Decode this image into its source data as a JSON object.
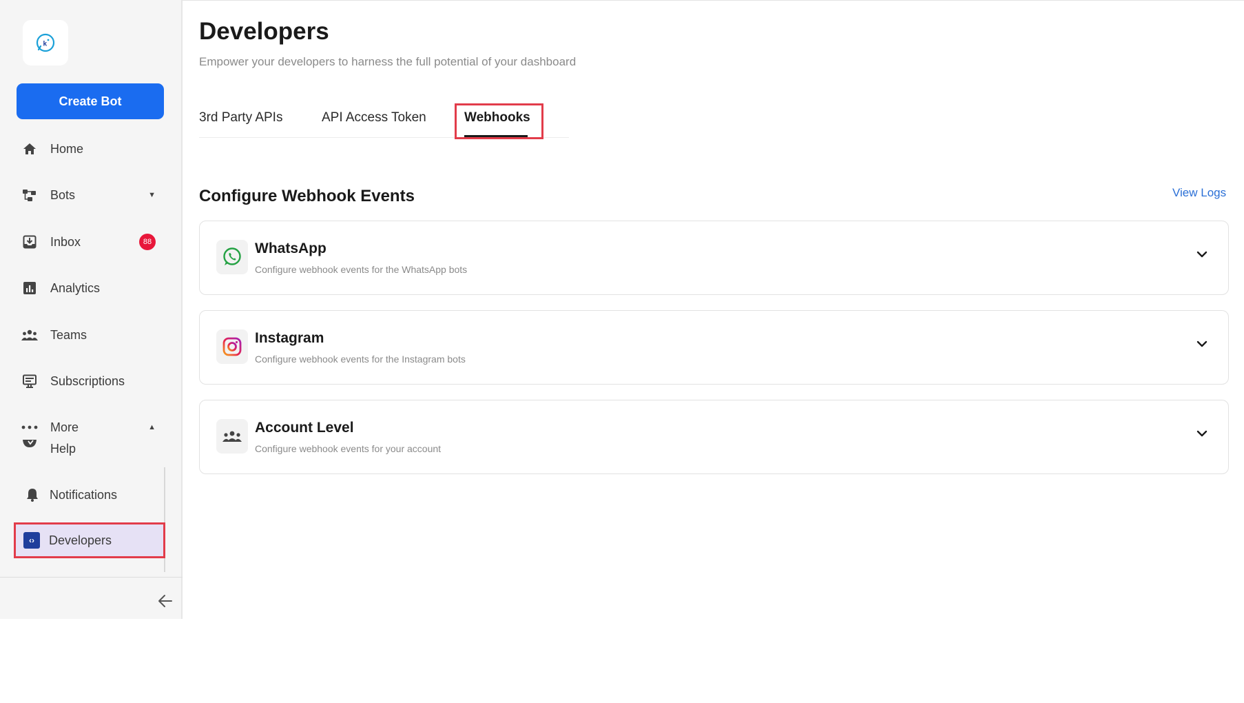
{
  "sidebar": {
    "logo_icon": "chat-bubble-logo-icon",
    "create_bot_label": "Create Bot",
    "items": [
      {
        "label": "Home",
        "icon": "home-icon"
      },
      {
        "label": "Bots",
        "icon": "bots-icon"
      },
      {
        "label": "Inbox",
        "icon": "inbox-icon",
        "badge": "88"
      },
      {
        "label": "Analytics",
        "icon": "analytics-icon"
      },
      {
        "label": "Teams",
        "icon": "teams-icon"
      },
      {
        "label": "Subscriptions",
        "icon": "subscriptions-icon"
      },
      {
        "label": "More",
        "icon": "more-icon"
      },
      {
        "label": "Help",
        "icon": "help-icon"
      },
      {
        "label": "Notifications",
        "icon": "bell-icon"
      },
      {
        "label": "Developers",
        "icon": "code-icon"
      }
    ],
    "active_item": "Developers"
  },
  "header": {
    "title": "Developers",
    "subtitle": "Empower your developers to harness the full potential of your dashboard"
  },
  "tabs": [
    {
      "label": "3rd Party APIs"
    },
    {
      "label": "API Access Token"
    },
    {
      "label": "Webhooks"
    }
  ],
  "active_tab": "Webhooks",
  "section": {
    "title": "Configure Webhook Events",
    "view_logs_label": "View Logs"
  },
  "cards": [
    {
      "title": "WhatsApp",
      "description": "Configure webhook events for the WhatsApp bots",
      "icon": "whatsapp-icon"
    },
    {
      "title": "Instagram",
      "description": "Configure webhook events for the Instagram bots",
      "icon": "instagram-icon"
    },
    {
      "title": "Account Level",
      "description": "Configure webhook events for your account",
      "icon": "account-group-icon"
    }
  ],
  "colors": {
    "primary": "#1a6cf0",
    "highlight_border": "#e23c4a",
    "badge": "#e8173a",
    "link": "#2a6fd6",
    "whatsapp": "#25a244"
  }
}
